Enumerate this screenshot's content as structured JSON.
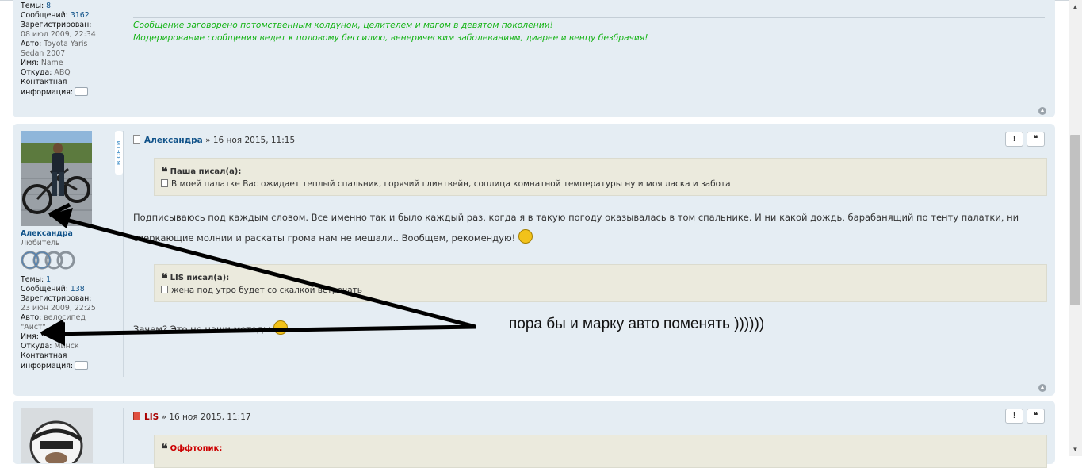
{
  "post1": {
    "profile": {
      "topics_label": "Темы:",
      "topics_value": "8",
      "messages_label": "Сообщений:",
      "messages_value": "3162",
      "registered_label": "Зарегистрирован:",
      "registered_value": "08 июл 2009, 22:34",
      "auto_label": "Авто:",
      "auto_value_1": "Toyota Yaris",
      "auto_value_2": "Sedan 2007",
      "name_label": "Имя:",
      "name_value": "Name",
      "from_label": "Откуда:",
      "from_value": "ABQ",
      "contact_label_1": "Контактная",
      "contact_label_2": "информация:"
    },
    "signature": [
      "Сообщение заговорено потомственным колдуном, целителем и магом в девятом поколении!",
      "Модерирование сообщения ведет к половому бессилию, венерическим заболеваниям, диарее и венцу безбрачия!"
    ]
  },
  "post2": {
    "online_label": "В СЕТИ",
    "author": "Александра",
    "datetime": "» 16 ноя 2015, 11:15",
    "report_btn": "!",
    "quote_btn": "❝",
    "profile": {
      "username": "Александра",
      "rank": "Любитель",
      "topics_label": "Темы:",
      "topics_value": "1",
      "messages_label": "Сообщений:",
      "messages_value": "138",
      "registered_label": "Зарегистрирован:",
      "registered_value": "23 июн 2009, 22:25",
      "auto_label": "Авто:",
      "auto_value_1": "велосипед",
      "auto_value_2": "\"Аист\"",
      "name_label": "Имя:",
      "from_label": "Откуда:",
      "from_value": "Минск",
      "contact_label_1": "Контактная",
      "contact_label_2": "информация:"
    },
    "quote1": {
      "cite": "Паша писал(а):",
      "text": "В моей палатке Вас ожидает теплый спальник, горячий глинтвейн, соплица комнатной температуры ну и моя ласка и забота"
    },
    "body_line1": "Подписываюсь под каждым словом. Все именно так и было каждый раз, когда я в такую погоду оказывалась в том спальнике. И ни какой дождь, барабанящий по тенту палатки, ни",
    "body_line2": "сверкающие молнии и раскаты грома нам не мешали.. Вообщем, рекомендую!",
    "quote2": {
      "cite": "LIS писал(а):",
      "text": "жена под утро будет со скалкой встречать"
    },
    "body_line3": "Зачем? Это не наши методы"
  },
  "post3": {
    "author": "LIS",
    "datetime": "» 16 ноя 2015, 11:17",
    "report_btn": "!",
    "quote_btn": "❝",
    "offtopic_cite": "Оффтопик:"
  },
  "annotation": "пора бы и марку авто поменять ))))))",
  "top_icon": "▲",
  "colors": {
    "post_bg": "#e5edf3",
    "signature": "#14b314",
    "link": "#105289",
    "quote_bg": "#ebeadd"
  }
}
